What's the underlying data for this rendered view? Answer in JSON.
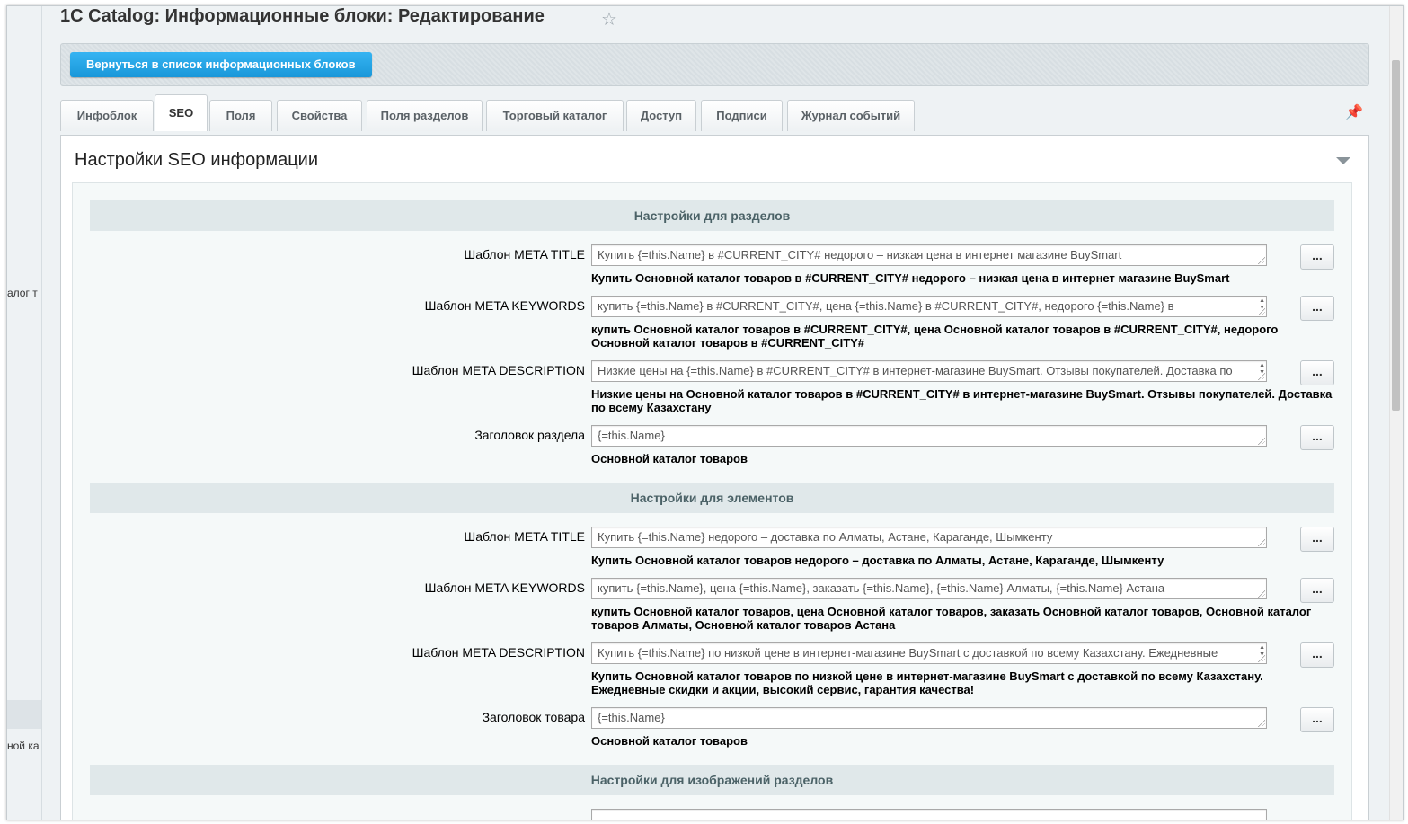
{
  "page": {
    "title": "1C Catalog: Информационные блоки: Редактирование",
    "back_button": "Вернуться в список информационных блоков",
    "left_panel": {
      "item1": "алог т",
      "item2": "ной ка"
    }
  },
  "tabs": [
    {
      "label": "Инфоблок",
      "active": false
    },
    {
      "label": "SEO",
      "active": true
    },
    {
      "label": "Поля",
      "active": false
    },
    {
      "label": "Свойства",
      "active": false
    },
    {
      "label": "Поля разделов",
      "active": false
    },
    {
      "label": "Торговый каталог",
      "active": false
    },
    {
      "label": "Доступ",
      "active": false
    },
    {
      "label": "Подписи",
      "active": false
    },
    {
      "label": "Журнал событий",
      "active": false
    }
  ],
  "panel": {
    "title": "Настройки SEO информации",
    "more_button": "...",
    "sections": [
      {
        "title": "Настройки для разделов",
        "rows": [
          {
            "label": "Шаблон META TITLE",
            "value": "Купить {=this.Name} в #CURRENT_CITY# недорого – низкая цена в интернет магазине BuySmart",
            "preview": "Купить Основной каталог товаров в #CURRENT_CITY# недорого – низкая цена в интернет магазине BuySmart"
          },
          {
            "label": "Шаблон META KEYWORDS",
            "value": "купить {=this.Name} в #CURRENT_CITY#, цена {=this.Name} в #CURRENT_CITY#, недорого {=this.Name} в",
            "preview": "купить Основной каталог товаров в #CURRENT_CITY#, цена Основной каталог товаров в #CURRENT_CITY#, недорого Основной каталог товаров в #CURRENT_CITY#"
          },
          {
            "label": "Шаблон META DESCRIPTION",
            "value": "Низкие цены на {=this.Name} в #CURRENT_CITY# в интернет-магазине BuySmart. Отзывы покупателей. Доставка по",
            "preview": "Низкие цены на Основной каталог товаров в #CURRENT_CITY# в интернет-магазине BuySmart. Отзывы покупателей. Доставка по всему Казахстану"
          },
          {
            "label": "Заголовок раздела",
            "value": "{=this.Name}",
            "preview": "Основной каталог товаров"
          }
        ]
      },
      {
        "title": "Настройки для элементов",
        "rows": [
          {
            "label": "Шаблон META TITLE",
            "value": "Купить {=this.Name} недорого – доставка по Алматы, Астане, Караганде, Шымкенту",
            "preview": "Купить Основной каталог товаров недорого – доставка по Алматы, Астане, Караганде, Шымкенту"
          },
          {
            "label": "Шаблон META KEYWORDS",
            "value": "купить {=this.Name}, цена {=this.Name}, заказать {=this.Name}, {=this.Name} Алматы, {=this.Name} Астана",
            "preview": "купить Основной каталог товаров, цена Основной каталог товаров, заказать Основной каталог товаров, Основной каталог товаров Алматы, Основной каталог товаров Астана"
          },
          {
            "label": "Шаблон META DESCRIPTION",
            "value": "Купить {=this.Name} по низкой цене в интернет-магазине BuySmart с доставкой по всему Казахстану. Ежедневные",
            "preview": "Купить Основной каталог товаров по низкой цене в интернет-магазине BuySmart с доставкой по всему Казахстану. Ежедневные скидки и акции, высокий сервис, гарантия качества!"
          },
          {
            "label": "Заголовок товара",
            "value": "{=this.Name}",
            "preview": "Основной каталог товаров"
          }
        ]
      },
      {
        "title": "Настройки для изображений разделов",
        "rows": []
      }
    ]
  }
}
